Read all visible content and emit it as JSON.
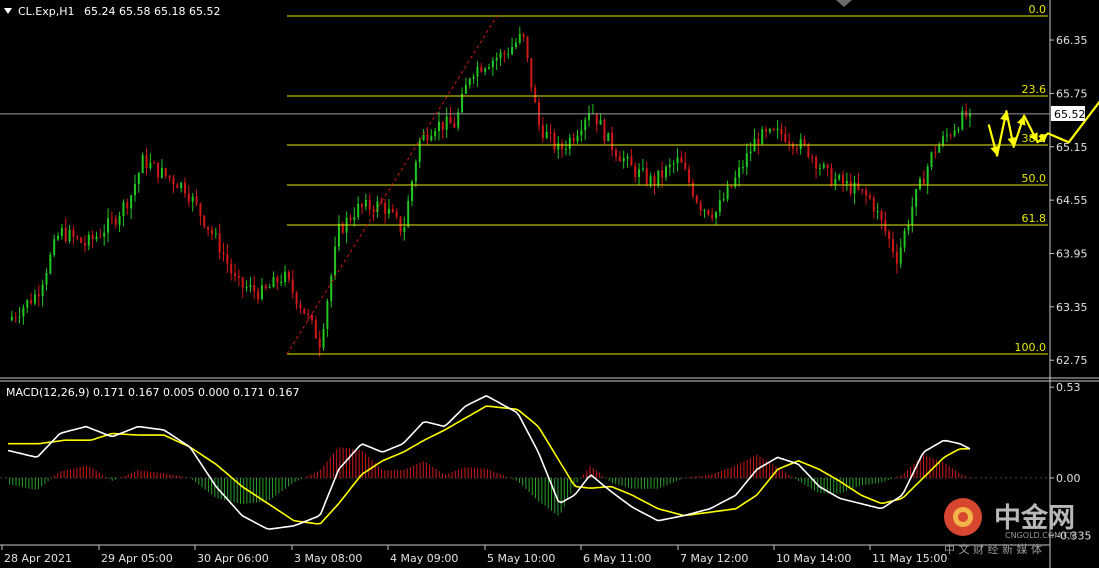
{
  "header": {
    "symbol_label": "CL.Exp,H1",
    "ohlc_label": "65.24 65.58 65.18 65.52",
    "macd_label": "MACD(12,26,9) 0.171 0.167 0.005 0.000 0.171 0.167"
  },
  "price_badge": "65.52",
  "watermark": {
    "brand": "中金网",
    "url": "CNGOLD.COM.CN",
    "slogan": "中 文 财 经 新 媒 体"
  },
  "colors": {
    "background": "#000000",
    "bull_candle": "#22c722",
    "bear_candle": "#d01818",
    "fib_line": "#e8e800",
    "arrow": "#ffff00",
    "macd_main": "#ffffff",
    "macd_signal": "#ffff00",
    "hist_pos": "#d01818",
    "hist_neg": "#2aa02a"
  },
  "chart_data": [
    {
      "type": "candlestick",
      "symbol": "CL.Exp",
      "timeframe": "H1",
      "last_price": 65.52,
      "ylim": [
        62.55,
        66.8
      ],
      "y_ticks": [
        "66.35",
        "65.75",
        "65.15",
        "64.55",
        "63.95",
        "63.35",
        "62.75"
      ],
      "x_ticks": [
        "28 Apr 2021",
        "29 Apr 05:00",
        "30 Apr 06:00",
        "3 May 08:00",
        "4 May 09:00",
        "5 May 10:00",
        "6 May 11:00",
        "7 May 12:00",
        "10 May 14:00",
        "11 May 15:00"
      ],
      "price_path": [
        [
          0,
          63.2
        ],
        [
          0.028,
          63.5
        ],
        [
          0.05,
          64.2
        ],
        [
          0.075,
          64.05
        ],
        [
          0.1,
          64.3
        ],
        [
          0.118,
          64.6
        ],
        [
          0.13,
          65.0
        ],
        [
          0.148,
          64.85
        ],
        [
          0.17,
          64.7
        ],
        [
          0.185,
          64.4
        ],
        [
          0.205,
          64.0
        ],
        [
          0.22,
          63.6
        ],
        [
          0.245,
          63.5
        ],
        [
          0.265,
          63.7
        ],
        [
          0.285,
          63.3
        ],
        [
          0.3,
          62.95
        ],
        [
          0.318,
          64.2
        ],
        [
          0.335,
          64.45
        ],
        [
          0.36,
          64.5
        ],
        [
          0.38,
          64.2
        ],
        [
          0.395,
          65.2
        ],
        [
          0.41,
          65.4
        ],
        [
          0.43,
          65.4
        ],
        [
          0.445,
          66.0
        ],
        [
          0.46,
          66.1
        ],
        [
          0.478,
          66.2
        ],
        [
          0.495,
          66.4
        ],
        [
          0.51,
          65.4
        ],
        [
          0.53,
          65.1
        ],
        [
          0.545,
          65.3
        ],
        [
          0.56,
          65.6
        ],
        [
          0.578,
          65.2
        ],
        [
          0.6,
          64.9
        ],
        [
          0.62,
          64.75
        ],
        [
          0.645,
          65.0
        ],
        [
          0.665,
          64.5
        ],
        [
          0.68,
          64.4
        ],
        [
          0.698,
          64.75
        ],
        [
          0.72,
          65.25
        ],
        [
          0.745,
          65.3
        ],
        [
          0.77,
          65.1
        ],
        [
          0.79,
          64.8
        ],
        [
          0.81,
          64.7
        ],
        [
          0.83,
          64.55
        ],
        [
          0.855,
          63.9
        ],
        [
          0.87,
          64.5
        ],
        [
          0.89,
          65.1
        ],
        [
          0.905,
          65.3
        ],
        [
          0.915,
          65.45
        ],
        [
          0.925,
          65.52
        ]
      ],
      "fibonacci": {
        "levels": [
          {
            "label": "0.0",
            "price": 66.62
          },
          {
            "label": "23.6",
            "price": 65.72
          },
          {
            "label": "38.2",
            "price": 65.17
          },
          {
            "label": "50.0",
            "price": 64.72
          },
          {
            "label": "61.8",
            "price": 64.27
          },
          {
            "label": "100.0",
            "price": 62.82
          }
        ]
      },
      "projection_path": [
        [
          0.943,
          65.4
        ],
        [
          0.951,
          65.05
        ],
        [
          0.96,
          65.55
        ],
        [
          0.967,
          65.15
        ],
        [
          0.977,
          65.5
        ],
        [
          0.99,
          65.2
        ],
        [
          1.0,
          65.3
        ],
        [
          1.02,
          65.2
        ],
        [
          1.075,
          66.05
        ]
      ]
    },
    {
      "type": "macd",
      "params": "12,26,9",
      "values": {
        "macd": 0.171,
        "signal": 0.167
      },
      "ylim": [
        -0.38,
        0.56
      ],
      "y_ticks": [
        "0.53",
        "0.00",
        "-0.335"
      ],
      "macd_path": [
        [
          0,
          0.16
        ],
        [
          0.028,
          0.12
        ],
        [
          0.05,
          0.26
        ],
        [
          0.075,
          0.3
        ],
        [
          0.1,
          0.24
        ],
        [
          0.125,
          0.3
        ],
        [
          0.15,
          0.28
        ],
        [
          0.175,
          0.18
        ],
        [
          0.2,
          -0.05
        ],
        [
          0.225,
          -0.22
        ],
        [
          0.25,
          -0.3
        ],
        [
          0.275,
          -0.28
        ],
        [
          0.3,
          -0.22
        ],
        [
          0.318,
          0.05
        ],
        [
          0.34,
          0.2
        ],
        [
          0.36,
          0.15
        ],
        [
          0.38,
          0.2
        ],
        [
          0.4,
          0.33
        ],
        [
          0.42,
          0.3
        ],
        [
          0.44,
          0.42
        ],
        [
          0.46,
          0.48
        ],
        [
          0.49,
          0.38
        ],
        [
          0.51,
          0.15
        ],
        [
          0.53,
          -0.15
        ],
        [
          0.545,
          -0.1
        ],
        [
          0.56,
          0.02
        ],
        [
          0.58,
          -0.08
        ],
        [
          0.6,
          -0.17
        ],
        [
          0.625,
          -0.25
        ],
        [
          0.65,
          -0.22
        ],
        [
          0.675,
          -0.18
        ],
        [
          0.7,
          -0.1
        ],
        [
          0.72,
          0.05
        ],
        [
          0.74,
          0.12
        ],
        [
          0.76,
          0.08
        ],
        [
          0.78,
          -0.05
        ],
        [
          0.8,
          -0.12
        ],
        [
          0.82,
          -0.15
        ],
        [
          0.84,
          -0.18
        ],
        [
          0.86,
          -0.1
        ],
        [
          0.88,
          0.15
        ],
        [
          0.9,
          0.22
        ],
        [
          0.915,
          0.2
        ],
        [
          0.925,
          0.17
        ]
      ],
      "signal_path": [
        [
          0,
          0.2
        ],
        [
          0.03,
          0.2
        ],
        [
          0.055,
          0.22
        ],
        [
          0.08,
          0.22
        ],
        [
          0.1,
          0.26
        ],
        [
          0.125,
          0.25
        ],
        [
          0.15,
          0.25
        ],
        [
          0.175,
          0.18
        ],
        [
          0.2,
          0.08
        ],
        [
          0.225,
          -0.05
        ],
        [
          0.25,
          -0.15
        ],
        [
          0.275,
          -0.25
        ],
        [
          0.3,
          -0.27
        ],
        [
          0.318,
          -0.15
        ],
        [
          0.34,
          0.02
        ],
        [
          0.36,
          0.1
        ],
        [
          0.38,
          0.15
        ],
        [
          0.4,
          0.22
        ],
        [
          0.42,
          0.28
        ],
        [
          0.44,
          0.35
        ],
        [
          0.46,
          0.42
        ],
        [
          0.49,
          0.4
        ],
        [
          0.51,
          0.3
        ],
        [
          0.53,
          0.1
        ],
        [
          0.545,
          -0.05
        ],
        [
          0.56,
          -0.06
        ],
        [
          0.58,
          -0.05
        ],
        [
          0.6,
          -0.1
        ],
        [
          0.625,
          -0.18
        ],
        [
          0.65,
          -0.22
        ],
        [
          0.675,
          -0.2
        ],
        [
          0.7,
          -0.18
        ],
        [
          0.72,
          -0.1
        ],
        [
          0.74,
          0.05
        ],
        [
          0.76,
          0.1
        ],
        [
          0.78,
          0.05
        ],
        [
          0.8,
          -0.02
        ],
        [
          0.82,
          -0.1
        ],
        [
          0.84,
          -0.15
        ],
        [
          0.86,
          -0.12
        ],
        [
          0.88,
          0.0
        ],
        [
          0.9,
          0.12
        ],
        [
          0.915,
          0.17
        ],
        [
          0.925,
          0.17
        ]
      ]
    }
  ]
}
